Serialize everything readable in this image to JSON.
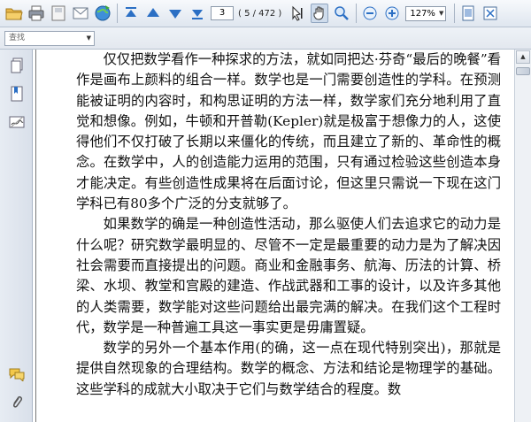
{
  "toolbar": {
    "page_number": "3",
    "page_count": "( 5 / 472 )",
    "zoom": "127%",
    "icons": [
      "open-folder-icon",
      "print-icon",
      "save-icon",
      "email-icon",
      "globe-icon",
      "first-page-icon",
      "previous-page-icon",
      "next-page-icon",
      "last-page-icon",
      "select-text-icon",
      "hand-tool-icon",
      "zoom-tool-icon",
      "zoom-out-icon",
      "zoom-in-icon",
      "single-page-icon",
      "fit-page-icon"
    ]
  },
  "find": {
    "placeholder": "查找"
  },
  "sidebar": {
    "icons": [
      "pages-icon",
      "bookmarks-icon",
      "signatures-icon",
      "comments-icon",
      "attachments-icon"
    ]
  },
  "document": {
    "paragraphs": [
      "仅仅把数学看作一种探求的方法，就如同把达·芬奇“最后的晚餐”看作是画布上颜料的组合一样。数学也是一门需要创造性的学科。在预测能被证明的内容时，和构思证明的方法一样，数学家们充分地利用了直觉和想像。例如，牛顿和开普勒(Kepler)就是极富于想像力的人，这使得他们不仅打破了长期以来僵化的传统，而且建立了新的、革命性的概念。在数学中，人的创造能力运用的范围，只有通过检验这些创造本身才能决定。有些创造性成果将在后面讨论，但这里只需说一下现在这门学科已有80多个广泛的分支就够了。",
      "如果数学的确是一种创造性活动，那么驱使人们去追求它的动力是什么呢？研究数学最明显的、尽管不一定是最重要的动力是为了解决因社会需要而直接提出的问题。商业和金融事务、航海、历法的计算、桥梁、水坝、教堂和宫殿的建造、作战武器和工事的设计，以及许多其他的人类需要，数学能对这些问题给出最完满的解决。在我们这个工程时代，数学是一种普遍工具这一事实更是毋庸置疑。",
      "数学的另外一个基本作用(的确，这一点在现代特别突出)，那就是提供自然现象的合理结构。数学的概念、方法和结论是物理学的基础。这些学科的成就大小取决于它们与数学结合的程度。数"
    ]
  },
  "colors": {
    "toolbar_bg": "#e6ecf3",
    "sidebar_bg": "#dfe5ed",
    "accent": "#2b6fc4"
  }
}
